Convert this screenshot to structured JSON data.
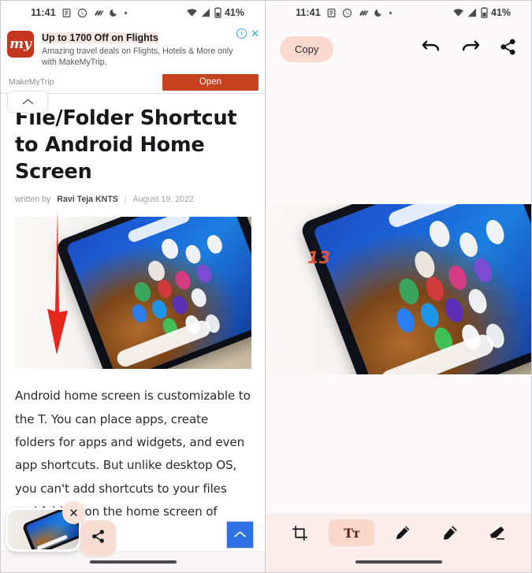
{
  "left": {
    "statusbar": {
      "time": "11:41",
      "battery_pct": "41%",
      "icons": [
        "note-icon",
        "whatsapp-icon",
        "app-icon",
        "do-not-disturb-moon-icon",
        "dot-icon"
      ],
      "right_icons": [
        "wifi-icon",
        "cellular-signal-icon",
        "battery-icon"
      ]
    },
    "ad": {
      "logo_text": "my",
      "headline": "Up to 1700 Off on Flights",
      "description": "Amazing travel deals on Flights, Hotels & More only with MakeMyTrip.",
      "advertiser": "MakeMyTrip",
      "cta_label": "Open",
      "info_label": "i",
      "close_label": "✕",
      "brand_color": "#c5411f",
      "highlight_color": "#f6e6e2"
    },
    "article": {
      "collapse_icon": "chevron-up-icon",
      "title": "File/Folder Shortcut to Android Home Screen",
      "byline_prefix": "written by",
      "author": "Ravi Teja KNTS",
      "separator": "|",
      "date": "August 19, 2022",
      "hero_image_alt": "phone-on-table-photo",
      "body": "Android home screen is customizable to the T. You can place apps, create folders for apps and widgets, and even app shortcuts. But unlike desktop OS, you can't add shortcuts to your files and folders on the home screen of"
    },
    "floating": {
      "thumbnail_name": "screenshot-thumbnail",
      "close_label": "✕",
      "share_icon": "share-icon",
      "scroll_top_icon": "chevron-up-icon",
      "scroll_top_color": "#2f6fe4"
    },
    "nav_pill": "home-gesture-pill"
  },
  "right": {
    "statusbar": {
      "time": "11:41",
      "battery_pct": "41%",
      "icons": [
        "note-icon",
        "whatsapp-icon",
        "app-icon",
        "do-not-disturb-moon-icon",
        "dot-icon"
      ],
      "right_icons": [
        "wifi-icon",
        "cellular-signal-icon",
        "battery-icon"
      ]
    },
    "toolbar": {
      "copy_label": "Copy",
      "copy_bg": "#f9d9cd",
      "undo_icon": "undo-arrow-icon",
      "redo_icon": "redo-arrow-icon",
      "share_icon": "share-icon"
    },
    "canvas": {
      "image_alt": "cropped-phone-on-table-photo",
      "annotation_text": "13",
      "annotation_color": "#e8543a"
    },
    "tools": [
      {
        "name": "crop",
        "icon": "crop-icon",
        "label": "",
        "active": false
      },
      {
        "name": "text",
        "icon": "text-tool-icon",
        "label": "Tт",
        "active": true
      },
      {
        "name": "pen",
        "icon": "pen-icon",
        "label": "",
        "active": false
      },
      {
        "name": "marker",
        "icon": "marker-icon",
        "label": "",
        "active": false
      },
      {
        "name": "eraser",
        "icon": "eraser-icon",
        "label": "",
        "active": false
      }
    ],
    "toolbar_bg": "#fbeeea",
    "nav_pill": "home-gesture-pill"
  }
}
